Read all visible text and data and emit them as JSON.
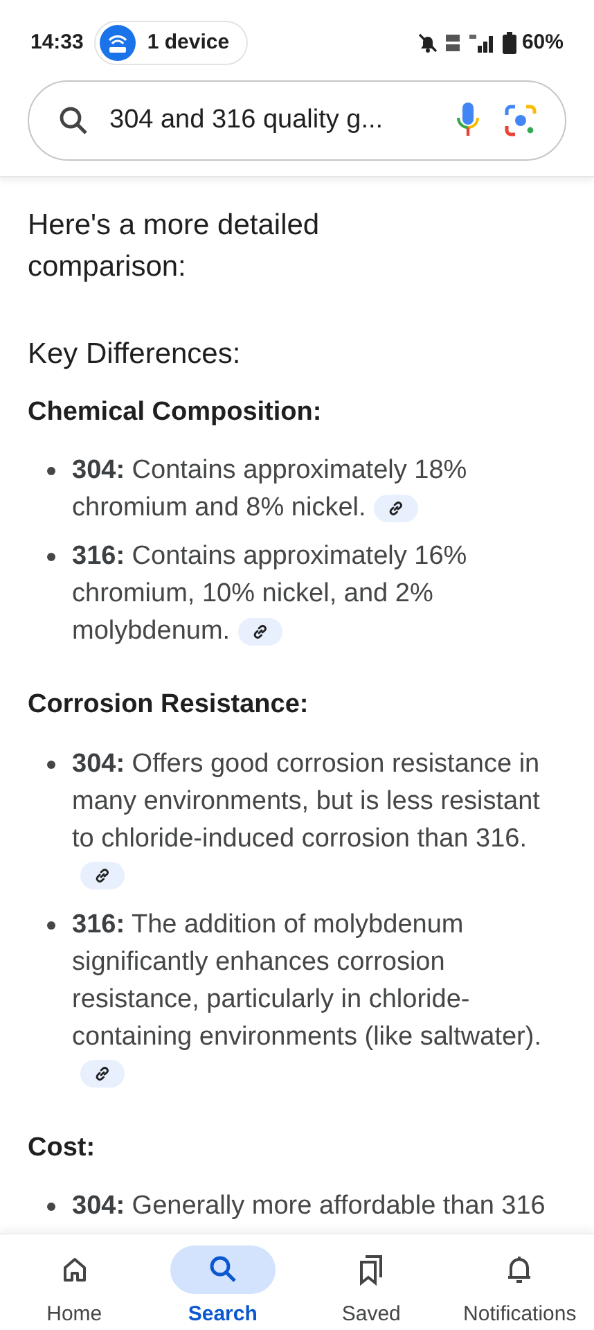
{
  "status_bar": {
    "time": "14:33",
    "device_chip": "1 device",
    "battery": "60%"
  },
  "search": {
    "query": "304 and 316 quality g..."
  },
  "intro": "Here's a more detailed comparison:",
  "heading": "Key Differences:",
  "sections": [
    {
      "title": "Chemical Composition:",
      "bullets": [
        {
          "text": "**304:** Contains approximately 18% chromium and 8% nickel.",
          "link": true
        },
        {
          "text": "**316:** Contains approximately 16% chromium, 10% nickel, and 2% molybdenum.",
          "link": true
        }
      ]
    },
    {
      "title": "Corrosion Resistance:",
      "bullets": [
        {
          "text": "**304:** Offers good corrosion resistance in many environments, but is less resistant to chloride-induced corrosion than 316.",
          "link": true
        },
        {
          "text": "**316:** The addition of molybdenum significantly enhances corrosion resistance, particularly in chloride-containing environments (like saltwater).",
          "link": true
        }
      ]
    },
    {
      "title": "Cost:",
      "bullets": [
        {
          "text": "**304:** Generally more affordable than 316",
          "link": false
        }
      ]
    }
  ],
  "nav": [
    {
      "label": "Home",
      "kind": "home",
      "selected": false
    },
    {
      "label": "Search",
      "kind": "search",
      "selected": true
    },
    {
      "label": "Saved",
      "kind": "saved",
      "selected": false
    },
    {
      "label": "Notifications",
      "kind": "bell",
      "selected": false
    }
  ]
}
